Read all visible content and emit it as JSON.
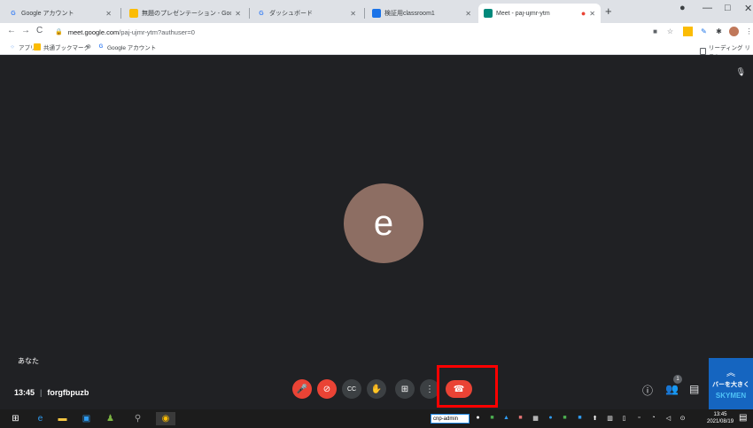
{
  "browser": {
    "tabs": [
      {
        "title": "Google アカウント",
        "favicon": "G",
        "color": "#4285f4"
      },
      {
        "title": "無題のプレゼンテーション - Google ス",
        "favicon": "▭",
        "color": "#fbbc04"
      },
      {
        "title": "ダッシュボード",
        "favicon": "G",
        "color": "#4285f4"
      },
      {
        "title": "検証用classroom1",
        "favicon": "▣",
        "color": "#1a73e8"
      },
      {
        "title": "Meet - paj-ujmr-ytm",
        "favicon": "▶",
        "color": "#00897b"
      }
    ],
    "new_tab": "+",
    "window": {
      "minimize": "—",
      "maximize": "□",
      "close": "✕"
    },
    "address": {
      "domain": "meet.google.com",
      "path": "/paj-ujmr-ytm?authuser=0"
    },
    "bookmarks": [
      {
        "label": "アプリ",
        "icon": "apps-grid-icon"
      },
      {
        "label": "共通ブックマーク",
        "icon": "folder-icon"
      },
      {
        "label": "",
        "icon": "globe-icon"
      },
      {
        "label": "Google アカウント",
        "icon": "google-icon"
      }
    ],
    "reading_list": "リーディング リスト"
  },
  "meet": {
    "avatar_letter": "e",
    "avatar_color": "#8d6e63",
    "you_label": "あなた",
    "time": "13:45",
    "meeting_code": "forgfbpuzb",
    "participants_count": "1",
    "controls": {
      "mic": "mic-off-icon",
      "camera": "camera-off-icon",
      "captions": "captions-icon",
      "hand": "raise-hand-icon",
      "present": "present-icon",
      "more": "more-vert-icon",
      "hangup": "hangup-icon"
    },
    "accent_red": "#ea4335"
  },
  "skymenu": {
    "line1": "バーを大きく",
    "brand": "SKYMEN"
  },
  "taskbar": {
    "input_label": "cnp-admin",
    "time": "13:45",
    "date": "2021/08/19"
  }
}
